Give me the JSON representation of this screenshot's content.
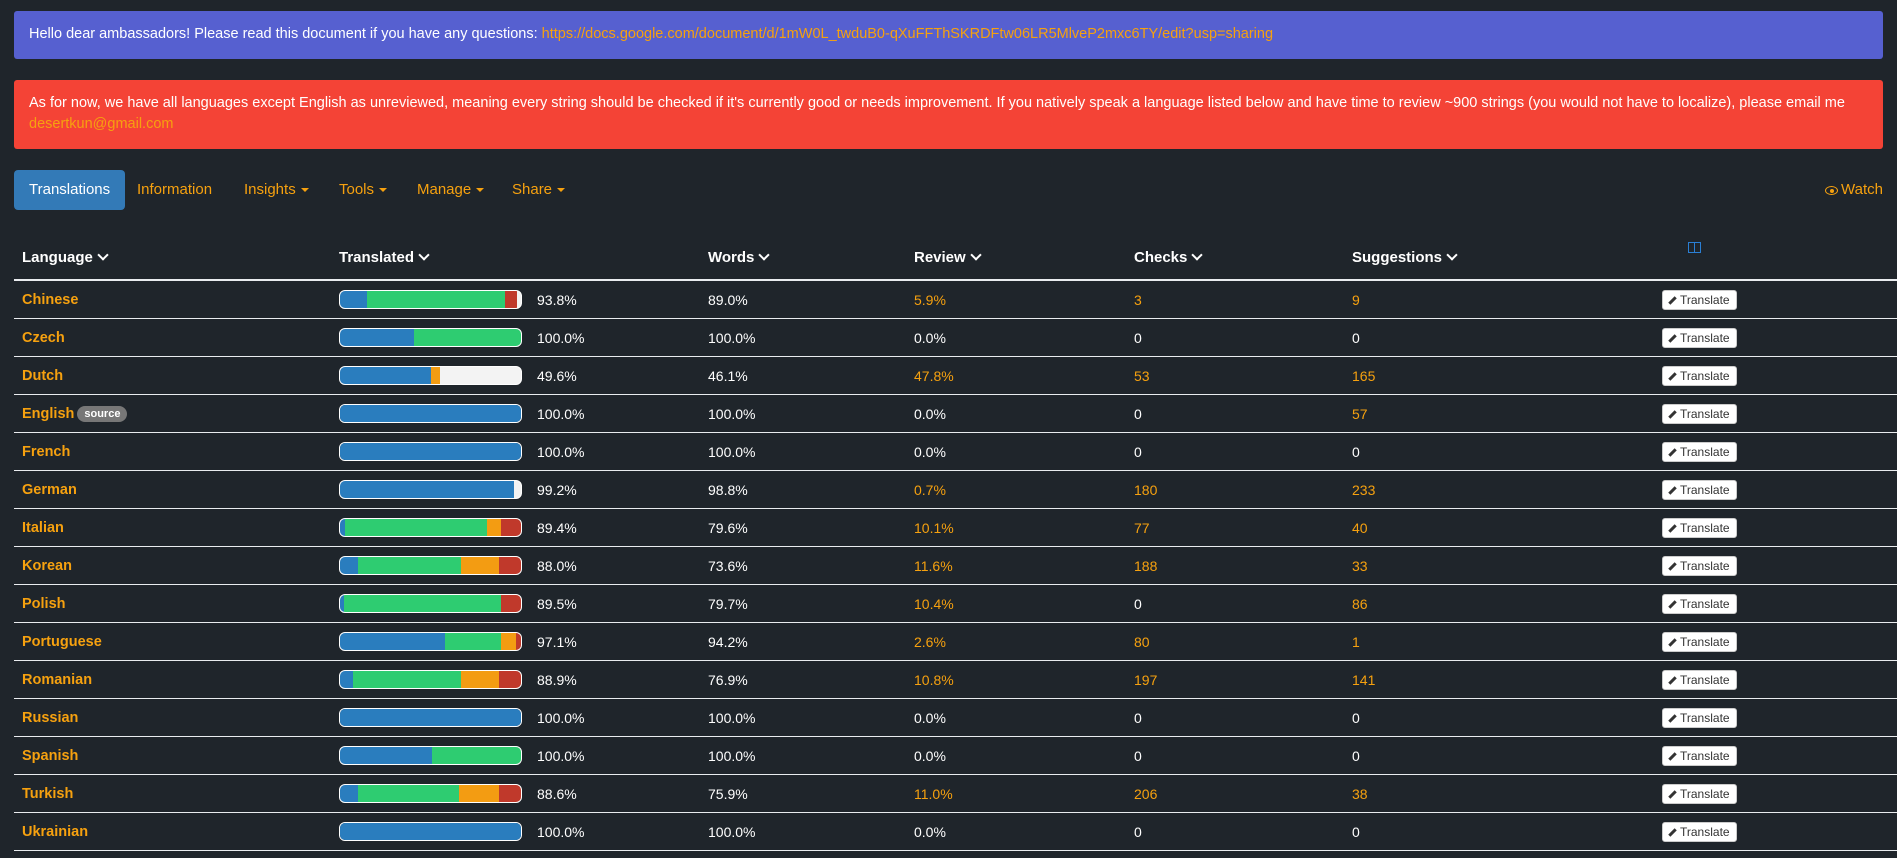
{
  "banner": {
    "text": "Hello dear ambassadors! Please read this document if you have any questions: ",
    "link": "https://docs.google.com/document/d/1mW0L_twduB0-qXuFFThSKRDFtw06LR5MlveP2mxc6TY/edit?usp=sharing"
  },
  "notice": {
    "text": "As for now, we have all languages except English as unreviewed, meaning every string should be checked if it's currently good or needs improvement. If you natively speak a language listed below and have time to review ~900 strings (you would not have to localize), please email me",
    "email": "desertkun@gmail.com"
  },
  "nav": {
    "translations": "Translations",
    "information": "Information",
    "insights": "Insights",
    "tools": "Tools",
    "manage": "Manage",
    "share": "Share",
    "watch": "Watch"
  },
  "columns": {
    "language": "Language",
    "translated": "Translated",
    "words": "Words",
    "review": "Review",
    "checks": "Checks",
    "suggestions": "Suggestions"
  },
  "colors": {
    "translated": "#2a7dbe",
    "approved": "#2ecc71",
    "review": "#f39c12",
    "failing": "#c0392b",
    "untranslated": "#f3f3f3",
    "accent": "#f6a10f"
  },
  "button_label": "Translate",
  "source_badge": "source",
  "rows": [
    {
      "language": "Chinese",
      "translated": "93.8%",
      "words": "89.0%",
      "review": "5.9%",
      "checks": "3",
      "suggestions": "9",
      "bar": {
        "blue": 15,
        "green": 76,
        "orange": 0,
        "red": 7
      }
    },
    {
      "language": "Czech",
      "translated": "100.0%",
      "words": "100.0%",
      "review": "0.0%",
      "checks": "0",
      "suggestions": "0",
      "bar": {
        "blue": 41,
        "green": 59,
        "orange": 0,
        "red": 0
      }
    },
    {
      "language": "Dutch",
      "translated": "49.6%",
      "words": "46.1%",
      "review": "47.8%",
      "checks": "53",
      "suggestions": "165",
      "bar": {
        "blue": 50,
        "green": 0,
        "orange": 5,
        "red": 0
      }
    },
    {
      "language": "English",
      "source": true,
      "translated": "100.0%",
      "words": "100.0%",
      "review": "0.0%",
      "checks": "0",
      "suggestions": "57",
      "bar": {
        "blue": 100,
        "green": 0,
        "orange": 0,
        "red": 0
      }
    },
    {
      "language": "French",
      "translated": "100.0%",
      "words": "100.0%",
      "review": "0.0%",
      "checks": "0",
      "suggestions": "0",
      "bar": {
        "blue": 100,
        "green": 0,
        "orange": 0,
        "red": 0
      }
    },
    {
      "language": "German",
      "translated": "99.2%",
      "words": "98.8%",
      "review": "0.7%",
      "checks": "180",
      "suggestions": "233",
      "bar": {
        "blue": 96,
        "green": 0,
        "orange": 0,
        "red": 0
      }
    },
    {
      "language": "Italian",
      "translated": "89.4%",
      "words": "79.6%",
      "review": "10.1%",
      "checks": "77",
      "suggestions": "40",
      "bar": {
        "blue": 3,
        "green": 78,
        "orange": 8,
        "red": 11
      }
    },
    {
      "language": "Korean",
      "translated": "88.0%",
      "words": "73.6%",
      "review": "11.6%",
      "checks": "188",
      "suggestions": "33",
      "bar": {
        "blue": 10,
        "green": 57,
        "orange": 21,
        "red": 12
      }
    },
    {
      "language": "Polish",
      "translated": "89.5%",
      "words": "79.7%",
      "review": "10.4%",
      "checks": "0",
      "suggestions": "86",
      "bar": {
        "blue": 2,
        "green": 87,
        "orange": 0,
        "red": 11
      }
    },
    {
      "language": "Portuguese",
      "translated": "97.1%",
      "words": "94.2%",
      "review": "2.6%",
      "checks": "80",
      "suggestions": "1",
      "bar": {
        "blue": 58,
        "green": 31,
        "orange": 8,
        "red": 3
      }
    },
    {
      "language": "Romanian",
      "translated": "88.9%",
      "words": "76.9%",
      "review": "10.8%",
      "checks": "197",
      "suggestions": "141",
      "bar": {
        "blue": 7,
        "green": 60,
        "orange": 21,
        "red": 12
      }
    },
    {
      "language": "Russian",
      "translated": "100.0%",
      "words": "100.0%",
      "review": "0.0%",
      "checks": "0",
      "suggestions": "0",
      "bar": {
        "blue": 100,
        "green": 0,
        "orange": 0,
        "red": 0
      }
    },
    {
      "language": "Spanish",
      "translated": "100.0%",
      "words": "100.0%",
      "review": "0.0%",
      "checks": "0",
      "suggestions": "0",
      "bar": {
        "blue": 51,
        "green": 49,
        "orange": 0,
        "red": 0
      }
    },
    {
      "language": "Turkish",
      "translated": "88.6%",
      "words": "75.9%",
      "review": "11.0%",
      "checks": "206",
      "suggestions": "38",
      "bar": {
        "blue": 10,
        "green": 56,
        "orange": 22,
        "red": 12
      }
    },
    {
      "language": "Ukrainian",
      "translated": "100.0%",
      "words": "100.0%",
      "review": "0.0%",
      "checks": "0",
      "suggestions": "0",
      "bar": {
        "blue": 100,
        "green": 0,
        "orange": 0,
        "red": 0
      }
    }
  ]
}
